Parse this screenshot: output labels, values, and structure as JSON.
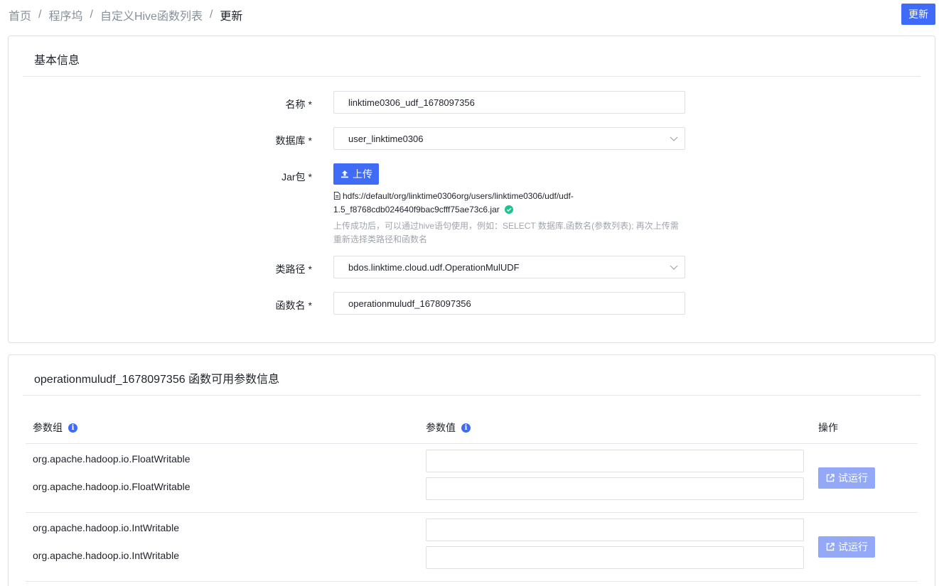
{
  "breadcrumb": {
    "items": [
      "首页",
      "程序坞",
      "自定义Hive函数列表",
      "更新"
    ],
    "separator": "/"
  },
  "header": {
    "update_button": "更新"
  },
  "basic_info": {
    "title": "基本信息",
    "required_mark": "*",
    "name": {
      "label": "名称",
      "value": "linktime0306_udf_1678097356"
    },
    "database": {
      "label": "数据库",
      "value": "user_linktime0306"
    },
    "jar": {
      "label": "Jar包",
      "upload_button": "上传",
      "file_path_line1": "hdfs://default/org/linktime0306org/users/linktime0306/udf/udf-",
      "file_path_line2": "1.5_f8768cdb024640f9bac9cfff75ae73c6.jar",
      "hint_line1": "上传成功后，可以通过hive语句使用，例如：SELECT 数据库.函数名(参数列表); 再次上传需",
      "hint_line2": "重新选择类路径和函数名"
    },
    "class_path": {
      "label": "类路径",
      "value": "bdos.linktime.cloud.udf.OperationMulUDF"
    },
    "function_name": {
      "label": "函数名",
      "value": "operationmuludf_1678097356"
    }
  },
  "params": {
    "title": "operationmuludf_1678097356 函数可用参数信息",
    "columns": {
      "group": "参数组",
      "value": "参数值",
      "action": "操作"
    },
    "run_button": "试运行",
    "groups": [
      {
        "types": [
          "org.apache.hadoop.io.FloatWritable",
          "org.apache.hadoop.io.FloatWritable"
        ]
      },
      {
        "types": [
          "org.apache.hadoop.io.IntWritable",
          "org.apache.hadoop.io.IntWritable"
        ]
      }
    ]
  },
  "colors": {
    "primary": "#3f6bf6",
    "primary_disabled": "#93a9f8",
    "success": "#1fc28f",
    "border": "#dcdfe6"
  },
  "icons": {
    "upload": "upload-icon",
    "file": "file-icon",
    "success": "check-circle-icon",
    "info": "info-icon",
    "run": "external-link-icon",
    "dropdown": "chevron-down-icon"
  }
}
